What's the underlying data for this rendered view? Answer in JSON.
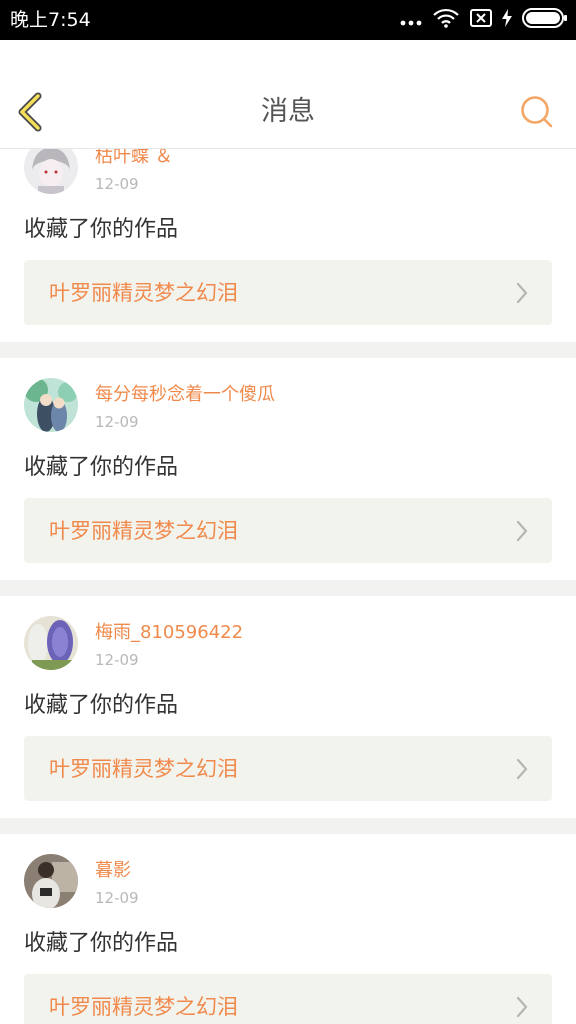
{
  "status_bar": {
    "time": "晚上7:54",
    "icons": [
      "more-dots-icon",
      "wifi-icon",
      "sim-blocked-icon",
      "charging-icon",
      "battery-icon"
    ]
  },
  "header": {
    "title": "消息",
    "back_icon": "chevron-left-icon",
    "search_icon": "search-icon",
    "accent_color": "#f08a4c"
  },
  "messages": [
    {
      "user": "枯叶蝶 ＆",
      "date": "12-09",
      "action": "收藏了你的作品",
      "work_title": "叶罗丽精灵梦之幻泪"
    },
    {
      "user": "每分每秒念着一个傻瓜",
      "date": "12-09",
      "action": "收藏了你的作品",
      "work_title": "叶罗丽精灵梦之幻泪"
    },
    {
      "user": "梅雨_810596422",
      "date": "12-09",
      "action": "收藏了你的作品",
      "work_title": "叶罗丽精灵梦之幻泪"
    },
    {
      "user": "暮影",
      "date": "12-09",
      "action": "收藏了你的作品",
      "work_title": "叶罗丽精灵梦之幻泪"
    }
  ]
}
